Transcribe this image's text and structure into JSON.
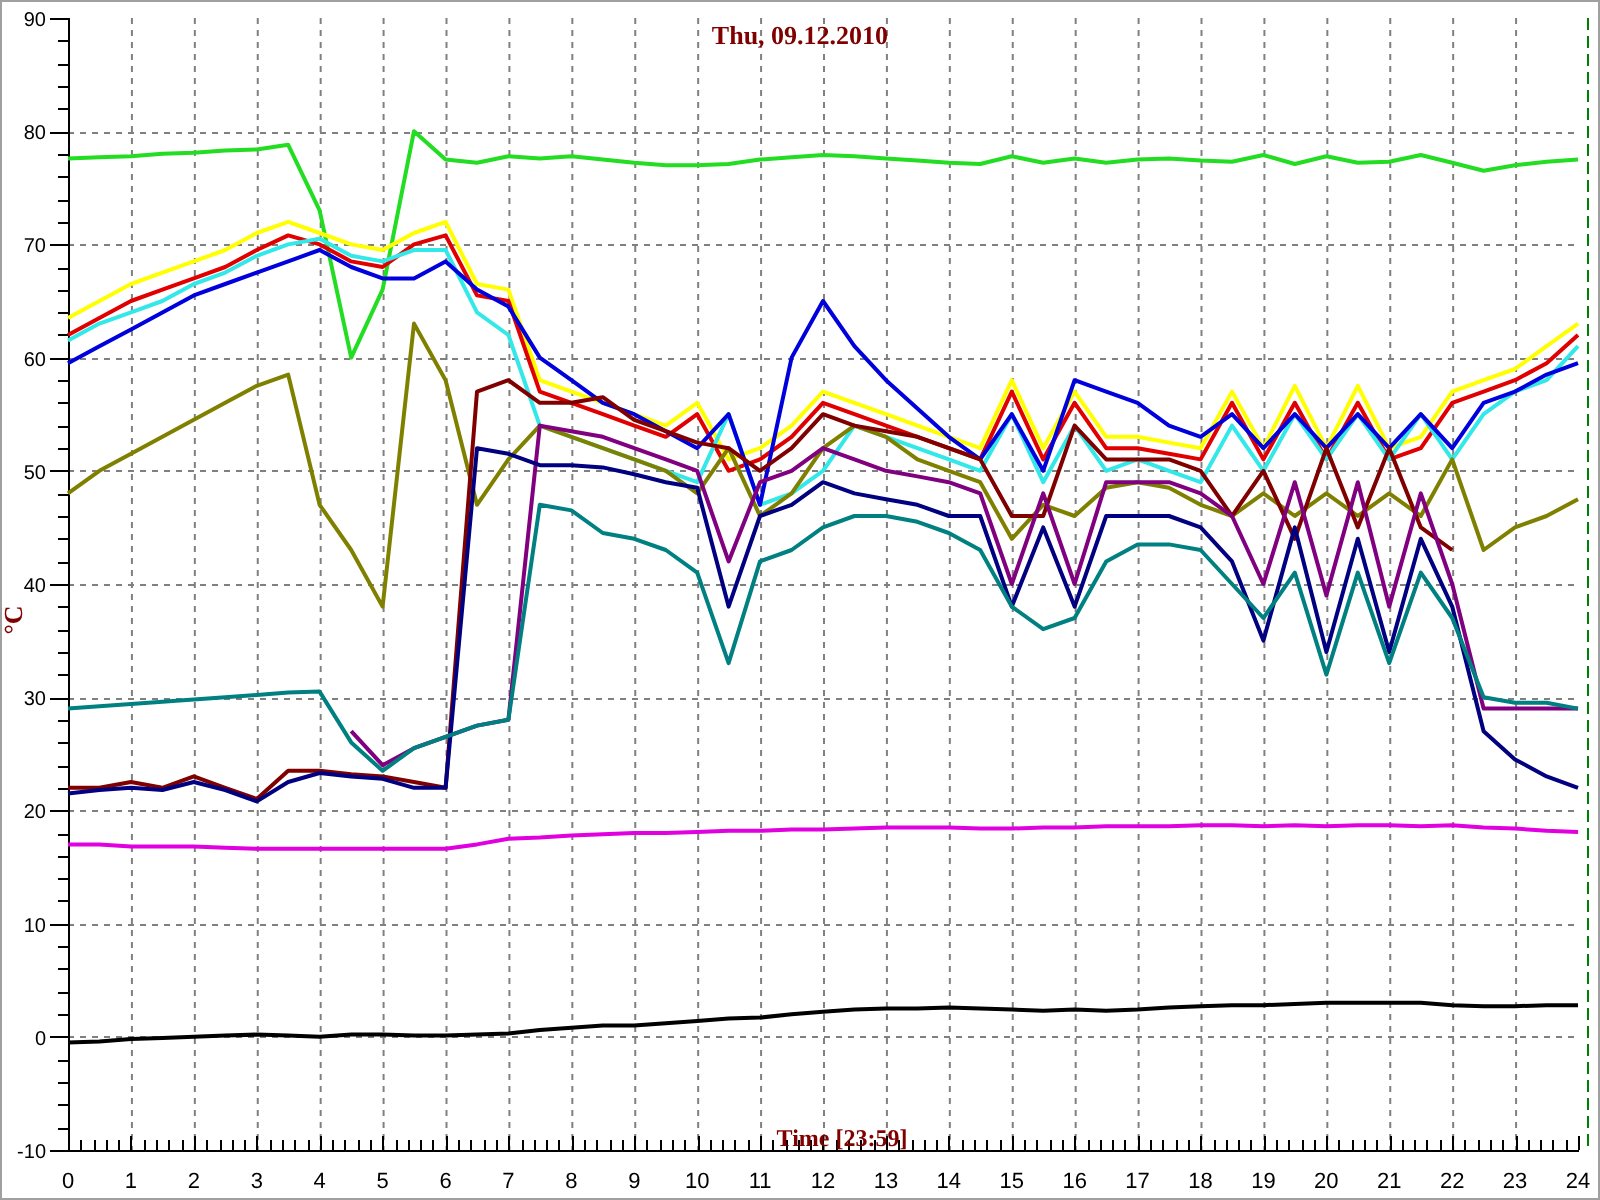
{
  "chart": {
    "chart_data": {
      "type": "line",
      "title": "Thu, 09.12.2010",
      "xlabel": "Time [23:59]",
      "ylabel": "°C",
      "x": [
        0,
        0.5,
        1,
        1.5,
        2,
        2.5,
        3,
        3.5,
        4,
        4.5,
        5,
        5.5,
        6,
        6.5,
        7,
        7.5,
        8,
        8.5,
        9,
        9.5,
        10,
        10.5,
        11,
        11.5,
        12,
        12.5,
        13,
        13.5,
        14,
        14.5,
        15,
        15.5,
        16,
        16.5,
        17,
        17.5,
        18,
        18.5,
        19,
        19.5,
        20,
        20.5,
        21,
        21.5,
        22,
        22.5,
        23,
        23.5,
        24
      ],
      "xlim": [
        0,
        24
      ],
      "ylim": [
        -10,
        90
      ],
      "xticks": [
        0,
        1,
        2,
        3,
        4,
        5,
        6,
        7,
        8,
        9,
        10,
        11,
        12,
        13,
        14,
        15,
        16,
        17,
        18,
        19,
        20,
        21,
        22,
        23,
        24
      ],
      "yticks": [
        -10,
        0,
        10,
        20,
        30,
        40,
        50,
        60,
        70,
        80,
        90
      ],
      "series": [
        {
          "color": "#22dd22",
          "values": [
            77.6,
            77.7,
            77.8,
            78,
            78.1,
            78.3,
            78.4,
            78.8,
            73,
            60,
            66,
            80,
            77.5,
            77.2,
            77.8,
            77.6,
            77.8,
            77.5,
            77.2,
            77,
            77,
            77.1,
            77.5,
            77.7,
            77.9,
            77.8,
            77.6,
            77.4,
            77.2,
            77.1,
            77.8,
            77.2,
            77.6,
            77.2,
            77.5,
            77.6,
            77.4,
            77.3,
            77.9,
            77.1,
            77.8,
            77.2,
            77.3,
            77.9,
            77.2,
            76.5,
            77,
            77.3,
            77.5
          ]
        },
        {
          "color": "#ffff00",
          "values": [
            63.5,
            65,
            66.5,
            67.5,
            68.5,
            69.5,
            71,
            72,
            71,
            70,
            69.5,
            71,
            72,
            66.5,
            66,
            58,
            57,
            56,
            55,
            54,
            56,
            51,
            52,
            54,
            57,
            56,
            55,
            54,
            53,
            52,
            58,
            52,
            57,
            53,
            53,
            52.5,
            52,
            57,
            52,
            57.5,
            52,
            57.5,
            52,
            53,
            57,
            58,
            59,
            61,
            63
          ]
        },
        {
          "color": "#e00000",
          "values": [
            62,
            63.5,
            65,
            66,
            67,
            68,
            69.5,
            70.8,
            70,
            68.5,
            68,
            70,
            70.8,
            65.5,
            65,
            57,
            56,
            55,
            54,
            53,
            55,
            50,
            51,
            53,
            56,
            55,
            54,
            53,
            52,
            51,
            57,
            51,
            56,
            52,
            52,
            51.5,
            51,
            56,
            51,
            56,
            51,
            56,
            51,
            52,
            56,
            57,
            58,
            59.5,
            62
          ]
        },
        {
          "color": "#33e8e8",
          "values": [
            61.5,
            63,
            64,
            65,
            66.5,
            67.5,
            69,
            70,
            70.5,
            69,
            68.5,
            69.5,
            69.5,
            64,
            62,
            54,
            53,
            52,
            51,
            50,
            49,
            55,
            47,
            48,
            50,
            54,
            53,
            52,
            51,
            50,
            55,
            49,
            54,
            50,
            51,
            50,
            49,
            54,
            50,
            55,
            51,
            55,
            51,
            55,
            51,
            55,
            57,
            58,
            61
          ]
        },
        {
          "color": "#0000dd",
          "values": [
            59.5,
            61,
            62.5,
            64,
            65.5,
            66.5,
            67.5,
            68.5,
            69.5,
            68,
            67,
            67,
            68.5,
            66,
            64.5,
            60,
            58,
            56,
            55,
            53.5,
            52,
            55,
            47,
            60,
            65,
            61,
            58,
            55.5,
            53,
            51,
            55,
            50,
            58,
            57,
            56,
            54,
            53,
            55,
            52,
            55,
            52,
            55,
            52,
            55,
            52,
            56,
            57,
            58.5,
            59.5
          ]
        },
        {
          "color": "#808000",
          "values": [
            48,
            50,
            51.5,
            53,
            54.5,
            56,
            57.5,
            58.5,
            47,
            43,
            38,
            63,
            58,
            47,
            51,
            54,
            53,
            52,
            51,
            50,
            48,
            52,
            46,
            48,
            52,
            54,
            53,
            51,
            50,
            49,
            44,
            47,
            46,
            48.5,
            49,
            48.5,
            47,
            46,
            48,
            46,
            48,
            46,
            48,
            46,
            51,
            43,
            45,
            46,
            47.5
          ]
        },
        {
          "color": "#800000",
          "values": [
            22,
            22,
            22.5,
            22,
            23,
            22,
            21,
            23.5,
            23.5,
            23.2,
            23,
            22.5,
            22,
            57,
            58,
            56,
            56,
            56.5,
            54.5,
            53.5,
            52.5,
            52,
            50,
            52,
            55,
            54,
            53.5,
            53,
            52,
            51,
            46,
            46,
            54,
            51,
            51,
            51,
            50,
            46,
            50,
            44,
            52,
            45,
            52,
            45,
            43,
            null,
            null,
            null,
            null
          ]
        },
        {
          "color": "#800080",
          "values": [
            null,
            null,
            null,
            null,
            null,
            null,
            null,
            null,
            null,
            27,
            24,
            25.5,
            26.5,
            27.5,
            28,
            54,
            53.5,
            53,
            52,
            51,
            50,
            42,
            49,
            50,
            52,
            51,
            50,
            49.5,
            49,
            48,
            40,
            48,
            40,
            49,
            49,
            49,
            48,
            46,
            40,
            49,
            39,
            49,
            38,
            48,
            40,
            29,
            29,
            29,
            29
          ]
        },
        {
          "color": "#000080",
          "values": [
            21.5,
            21.8,
            22,
            21.8,
            22.5,
            21.8,
            20.8,
            22.5,
            23.3,
            23,
            22.8,
            22,
            22,
            52,
            51.5,
            50.5,
            50.5,
            50.3,
            49.7,
            49,
            48.5,
            38,
            46,
            47,
            49,
            48,
            47.5,
            47,
            46,
            46,
            38,
            45,
            38,
            46,
            46,
            46,
            45,
            42,
            35,
            45,
            34,
            44,
            34,
            44,
            38,
            27,
            24.5,
            23,
            22
          ]
        },
        {
          "color": "#008080",
          "values": [
            29,
            29.2,
            29.4,
            29.6,
            29.8,
            30,
            30.2,
            30.4,
            30.5,
            26,
            23.5,
            25.5,
            26.5,
            27.5,
            28,
            47,
            46.5,
            44.5,
            44,
            43,
            41,
            33,
            42,
            43,
            45,
            46,
            46,
            45.5,
            44.5,
            43,
            38,
            36,
            37,
            42,
            43.5,
            43.5,
            43,
            40,
            37,
            41,
            32,
            41,
            33,
            41,
            37,
            30,
            29.5,
            29.5,
            29
          ]
        },
        {
          "color": "#e000e0",
          "values": [
            17,
            17,
            16.8,
            16.8,
            16.8,
            16.7,
            16.6,
            16.6,
            16.6,
            16.6,
            16.6,
            16.6,
            16.6,
            17,
            17.5,
            17.6,
            17.8,
            17.9,
            18,
            18,
            18.1,
            18.2,
            18.2,
            18.3,
            18.3,
            18.4,
            18.5,
            18.5,
            18.5,
            18.4,
            18.4,
            18.5,
            18.5,
            18.6,
            18.6,
            18.6,
            18.7,
            18.7,
            18.6,
            18.7,
            18.6,
            18.7,
            18.7,
            18.6,
            18.7,
            18.5,
            18.4,
            18.2,
            18.1
          ]
        },
        {
          "color": "#000000",
          "values": [
            -0.5,
            -0.4,
            -0.2,
            -0.1,
            0,
            0.1,
            0.2,
            0.1,
            0,
            0.2,
            0.2,
            0.1,
            0.1,
            0.2,
            0.3,
            0.6,
            0.8,
            1,
            1,
            1.2,
            1.4,
            1.6,
            1.7,
            2,
            2.2,
            2.4,
            2.5,
            2.5,
            2.6,
            2.5,
            2.4,
            2.3,
            2.4,
            2.3,
            2.4,
            2.6,
            2.7,
            2.8,
            2.8,
            2.9,
            3,
            3,
            3,
            3,
            2.8,
            2.7,
            2.7,
            2.8,
            2.8
          ]
        }
      ],
      "grid": true
    }
  }
}
